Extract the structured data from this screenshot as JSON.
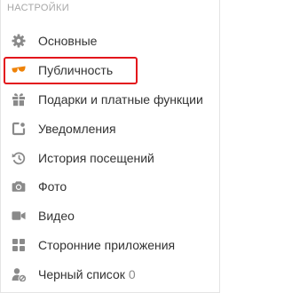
{
  "section": {
    "title": "НАСТРОЙКИ"
  },
  "menu": {
    "items": [
      {
        "label": "Основные",
        "icon": "gear-icon"
      },
      {
        "label": "Публичность",
        "icon": "sunglasses-icon",
        "active": true
      },
      {
        "label": "Подарки и платные функции",
        "icon": "gift-icon"
      },
      {
        "label": "Уведомления",
        "icon": "notification-icon"
      },
      {
        "label": "История посещений",
        "icon": "history-icon"
      },
      {
        "label": "Фото",
        "icon": "camera-icon"
      },
      {
        "label": "Видео",
        "icon": "video-camera-icon"
      },
      {
        "label": "Сторонние приложения",
        "icon": "apps-grid-icon"
      },
      {
        "label": "Черный список",
        "icon": "blocked-user-icon",
        "count": "0"
      }
    ]
  },
  "colors": {
    "icon_gray": "#8a8a8a",
    "accent_orange": "#ee8208",
    "highlight_red": "#e3161c",
    "section_title": "#a7a7a7",
    "text": "#333333"
  }
}
